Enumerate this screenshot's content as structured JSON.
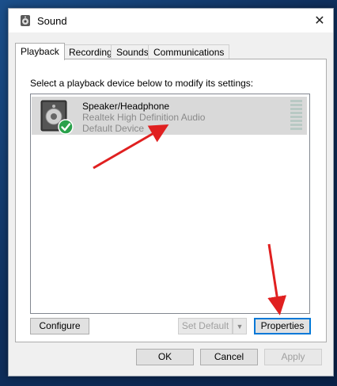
{
  "window": {
    "title": "Sound"
  },
  "tabs": [
    {
      "label": "Playback",
      "active": true
    },
    {
      "label": "Recording",
      "active": false
    },
    {
      "label": "Sounds",
      "active": false
    },
    {
      "label": "Communications",
      "active": false
    }
  ],
  "playback": {
    "instruction": "Select a playback device below to modify its settings:",
    "devices": [
      {
        "name": "Speaker/Headphone",
        "driver": "Realtek High Definition Audio",
        "status": "Default Device",
        "icon": "speaker-icon",
        "default_badge": "checkmark-icon"
      }
    ]
  },
  "panel_buttons": {
    "configure": "Configure",
    "set_default": "Set Default",
    "properties": "Properties"
  },
  "dialog_buttons": {
    "ok": "OK",
    "cancel": "Cancel",
    "apply": "Apply"
  },
  "colors": {
    "annotation_arrow": "#e02020",
    "default_check": "#2aa14b",
    "selection": "#d9d9d9"
  }
}
